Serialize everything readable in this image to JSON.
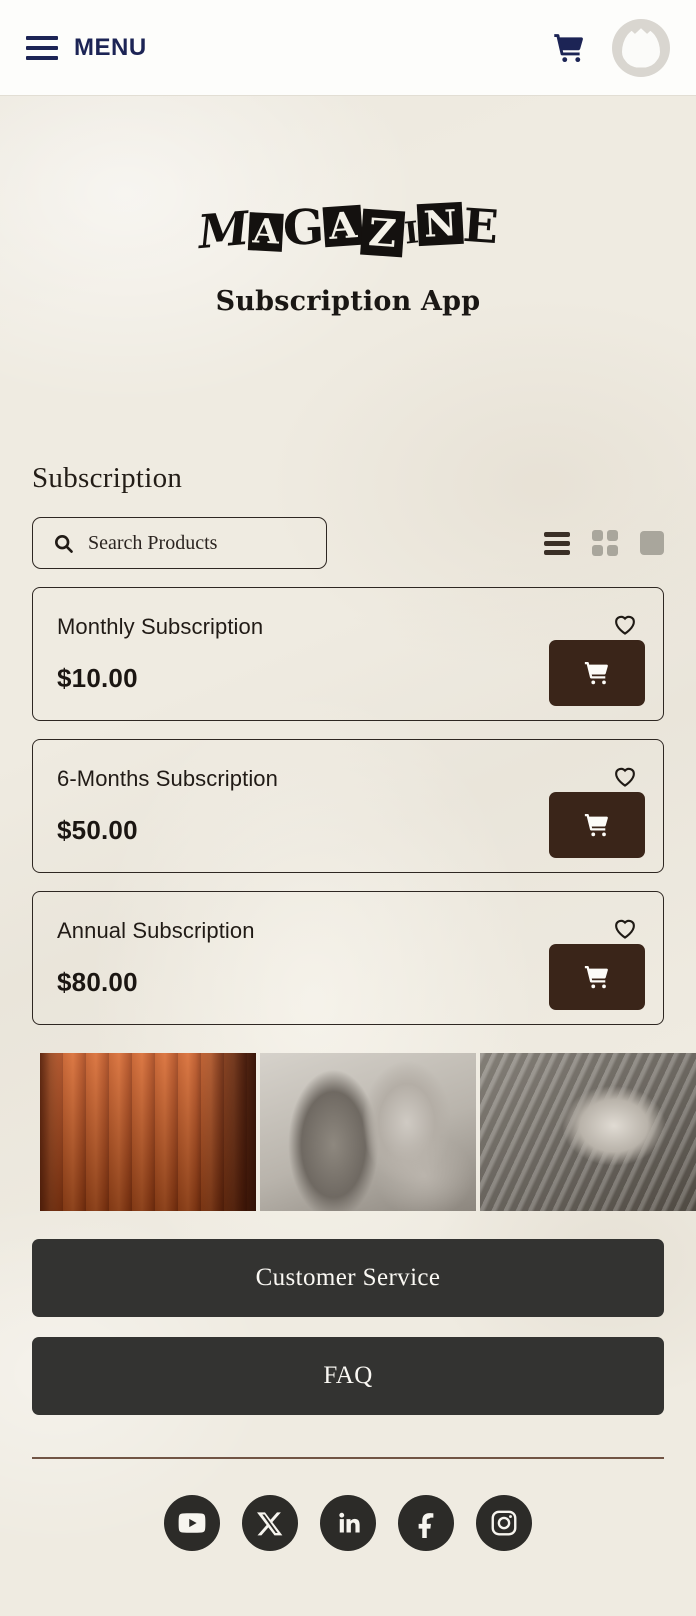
{
  "header": {
    "menu_label": "MENU",
    "menu_icon": "hamburger-icon",
    "cart_icon": "shopping-cart-icon",
    "avatar_icon": "user-avatar-placeholder",
    "menu_color": "#1c2455"
  },
  "hero": {
    "logo_text": "MAGAZINE",
    "logo_letters": [
      "M",
      "A",
      "G",
      "A",
      "Z",
      "I",
      "N",
      "E"
    ],
    "subtitle": "Subscription App"
  },
  "section": {
    "title": "Subscription"
  },
  "search": {
    "placeholder": "Search Products",
    "value": "",
    "icon": "search-icon"
  },
  "view_toggles": [
    {
      "name": "list-view",
      "icon": "list-view-icon",
      "active": true
    },
    {
      "name": "grid-view",
      "icon": "grid-view-icon",
      "active": false
    },
    {
      "name": "large-view",
      "icon": "large-tile-view-icon",
      "active": false
    }
  ],
  "products": [
    {
      "name": "Monthly Subscription",
      "price": "$10.00",
      "favorite_icon": "heart-outline-icon",
      "cart_icon": "shopping-cart-icon"
    },
    {
      "name": "6-Months Subscription",
      "price": "$50.00",
      "favorite_icon": "heart-outline-icon",
      "cart_icon": "shopping-cart-icon"
    },
    {
      "name": "Annual Subscription",
      "price": "$80.00",
      "favorite_icon": "heart-outline-icon",
      "cart_icon": "shopping-cart-icon"
    }
  ],
  "gallery": [
    {
      "name": "leather-furniture-image"
    },
    {
      "name": "woman-profile-portrait-image"
    },
    {
      "name": "fabric-bow-image"
    }
  ],
  "footer": {
    "customer_service_label": "Customer Service",
    "faq_label": "FAQ",
    "socials": [
      {
        "name": "youtube",
        "icon": "youtube-icon"
      },
      {
        "name": "x-twitter",
        "icon": "x-twitter-icon"
      },
      {
        "name": "linkedin",
        "icon": "linkedin-icon"
      },
      {
        "name": "facebook",
        "icon": "facebook-icon"
      },
      {
        "name": "instagram",
        "icon": "instagram-icon"
      }
    ]
  },
  "colors": {
    "background": "#efebe1",
    "navy": "#1c2455",
    "cart_button": "#3a2519",
    "footer_button": "#333331",
    "text": "#211b16"
  }
}
